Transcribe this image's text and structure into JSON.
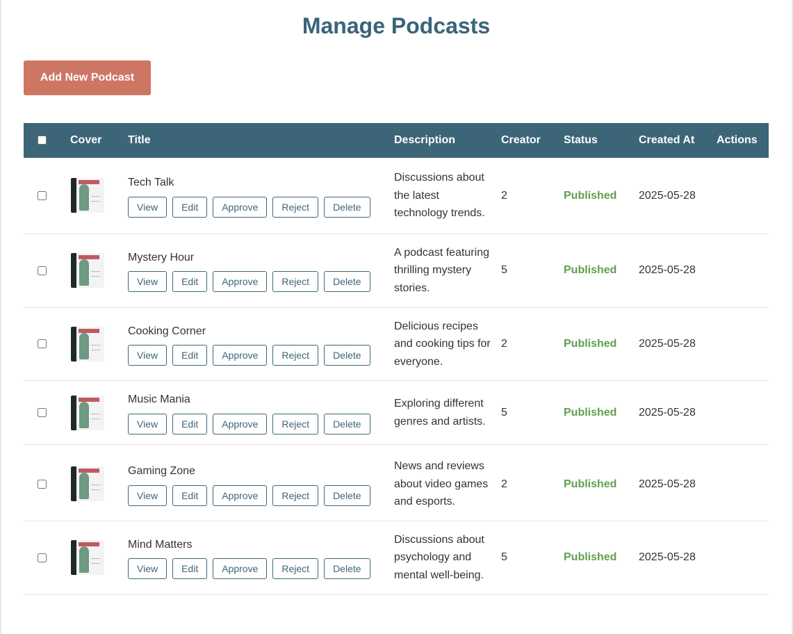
{
  "page": {
    "title": "Manage Podcasts",
    "add_button_label": "Add New Podcast"
  },
  "table": {
    "headers": {
      "cover": "Cover",
      "title": "Title",
      "description": "Description",
      "creator": "Creator",
      "status": "Status",
      "created_at": "Created At",
      "actions": "Actions"
    },
    "row_buttons": {
      "view": "View",
      "edit": "Edit",
      "approve": "Approve",
      "reject": "Reject",
      "delete": "Delete"
    },
    "rows": [
      {
        "title": "Tech Talk",
        "description": "Discussions about the latest technology trends.",
        "creator": "2",
        "status": "Published",
        "created_at": "2025-05-28"
      },
      {
        "title": "Mystery Hour",
        "description": "A podcast featuring thrilling mystery stories.",
        "creator": "5",
        "status": "Published",
        "created_at": "2025-05-28"
      },
      {
        "title": "Cooking Corner",
        "description": "Delicious recipes and cooking tips for everyone.",
        "creator": "2",
        "status": "Published",
        "created_at": "2025-05-28"
      },
      {
        "title": "Music Mania",
        "description": "Exploring different genres and artists.",
        "creator": "5",
        "status": "Published",
        "created_at": "2025-05-28"
      },
      {
        "title": "Gaming Zone",
        "description": "News and reviews about video games and esports.",
        "creator": "2",
        "status": "Published",
        "created_at": "2025-05-28"
      },
      {
        "title": "Mind Matters",
        "description": "Discussions about psychology and mental well-being.",
        "creator": "5",
        "status": "Published",
        "created_at": "2025-05-28"
      }
    ]
  },
  "colors": {
    "heading": "#3a6478",
    "table_header_bg": "#3c6578",
    "add_button_bg": "#cd7663",
    "status_published": "#5e9f4e"
  },
  "icons": {
    "cover_image": "podcast-cover-image"
  }
}
